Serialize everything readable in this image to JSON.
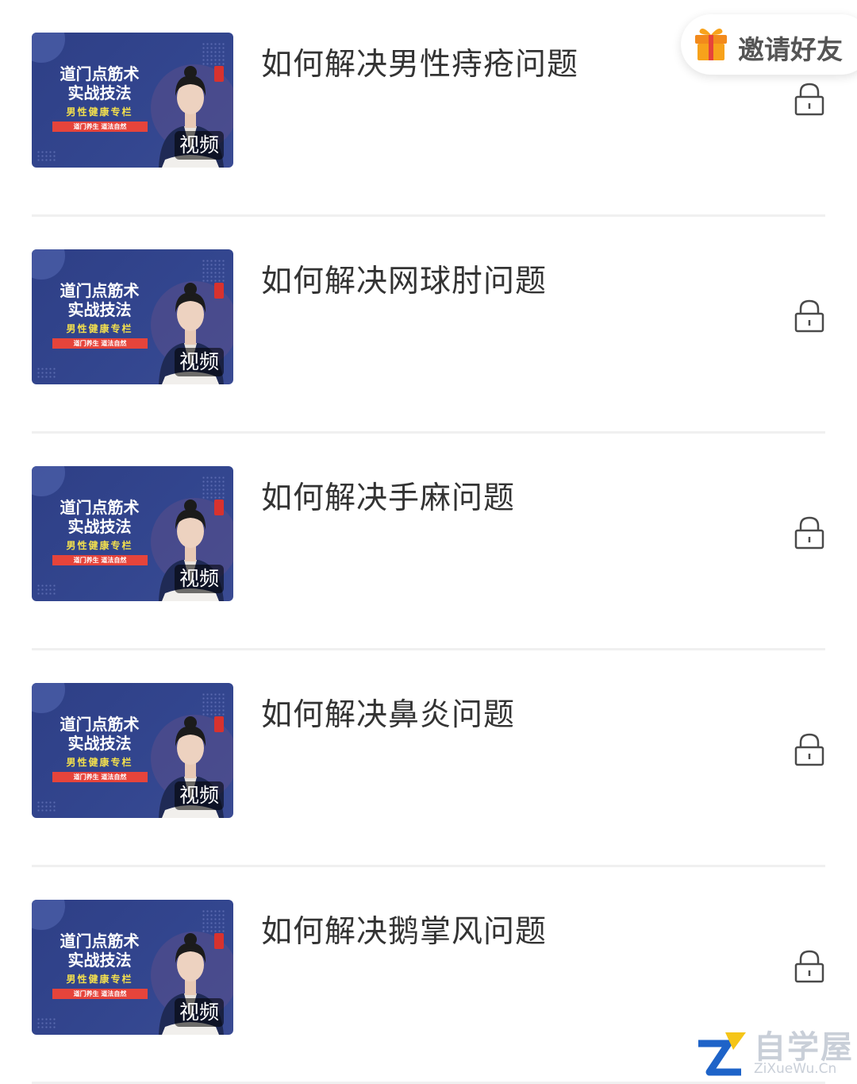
{
  "invite": {
    "label": "邀请好友",
    "icon": "gift-icon"
  },
  "thumbnail": {
    "line1": "道门点筋术",
    "line2": "实战技法",
    "line3": "男性健康专栏",
    "line4": "道门养生 道法自然",
    "badge": "视频"
  },
  "lessons": [
    {
      "title": "如何解决男性痔疮问题",
      "locked": true
    },
    {
      "title": "如何解决网球肘问题",
      "locked": true
    },
    {
      "title": "如何解决手麻问题",
      "locked": true
    },
    {
      "title": "如何解决鼻炎问题",
      "locked": true
    },
    {
      "title": "如何解决鹅掌风问题",
      "locked": true
    }
  ],
  "watermark": {
    "title": "自学屋",
    "subtitle": "ZiXueWu.Cn"
  },
  "colors": {
    "thumb_bg": "#2e3f86",
    "accent_red": "#e6443b",
    "text": "#333333"
  }
}
